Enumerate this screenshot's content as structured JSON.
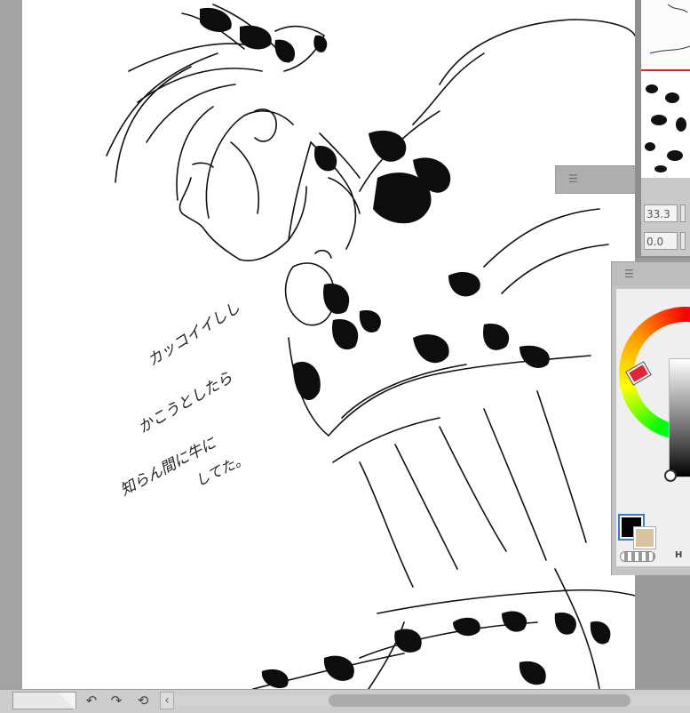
{
  "canvas": {
    "handwritten_note_lines": [
      "カッコイイしし",
      "かこうとしたら",
      "知らん間に牛に",
      "してた。"
    ]
  },
  "navigator": {
    "zoom_value": "33.3",
    "rotation_value": "0.0"
  },
  "color_panel": {
    "main_color": "#000000",
    "sub_color": "#d8c3a0",
    "hue_mode_label": "H"
  },
  "icons": {
    "undo": "undo-icon",
    "redo": "redo-icon",
    "reset_rotation": "rotate-reset-icon",
    "scroll_left": "chevron-left-icon",
    "panel_grip": "grip-icon"
  },
  "colors": {
    "workspace": "#9a9a9a",
    "navigator_frame": "#d12a2a",
    "selection_outline": "#3c76d6"
  }
}
